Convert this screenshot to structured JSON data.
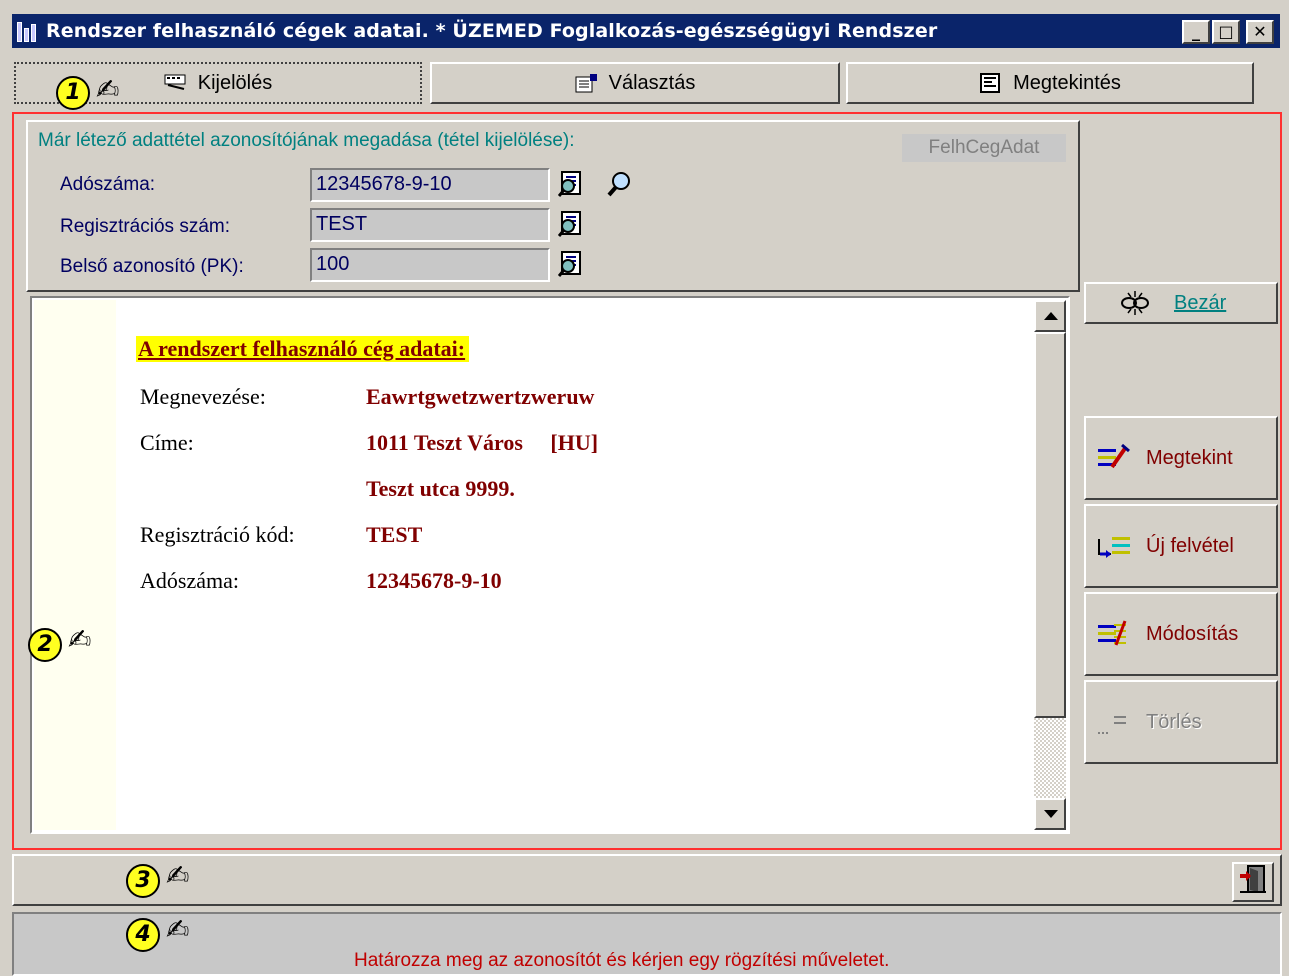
{
  "window": {
    "title": "Rendszer felhasználó cégek adatai. * ÜZEMED Foglalkozás-egészségügyi Rendszer",
    "minimize_glyph": "_",
    "maximize_glyph": "□",
    "close_glyph": "✕"
  },
  "tabs": [
    {
      "label": "Kijelölés",
      "icon": "keyboard-icon",
      "selected": true
    },
    {
      "label": "Választás",
      "icon": "select-list-icon",
      "selected": false
    },
    {
      "label": "Megtekintés",
      "icon": "view-document-icon",
      "selected": false
    }
  ],
  "markers": {
    "m1": "1",
    "m2": "2",
    "m3": "3",
    "m4": "4",
    "hand": "✍"
  },
  "identify": {
    "heading": "Már létező adattétel azonosítójának megadása (tétel kijelölése):",
    "table_name": "FelhCegAdat",
    "fields": [
      {
        "label": "Adószáma:",
        "value": "12345678-9-10"
      },
      {
        "label": "Regisztrációs szám:",
        "value": "TEST"
      },
      {
        "label": "Belső azonosító (PK):",
        "value": "100"
      }
    ]
  },
  "document": {
    "heading": "A rendszert felhasználó cég adatai:",
    "rows": [
      {
        "label": "Megnevezése:",
        "value": "Eawrtgwetzwertzweruw"
      },
      {
        "label": "Címe:",
        "value": "1011 Teszt Város     [HU]"
      },
      {
        "label": "",
        "value": "Teszt utca 9999."
      },
      {
        "label": "Regisztráció kód:",
        "value": "TEST"
      },
      {
        "label": "Adószáma:",
        "value": "12345678-9-10"
      }
    ]
  },
  "buttons": {
    "close": {
      "label": "Bezár"
    },
    "view": {
      "label": "Megtekint"
    },
    "new": {
      "label": "Új felvétel"
    },
    "modify": {
      "label": "Módosítás"
    },
    "delete": {
      "label": "Törlés",
      "enabled": false
    }
  },
  "status": {
    "message": "Határozza meg az azonosítót és kérjen egy rögzítési műveletet."
  },
  "colors": {
    "titlebar": "#0a246a",
    "frame_highlight": "#ff3030",
    "doc_heading_bg": "#ffff00",
    "doc_value": "#800000",
    "status_text": "#c00000",
    "group_heading": "#008080"
  }
}
